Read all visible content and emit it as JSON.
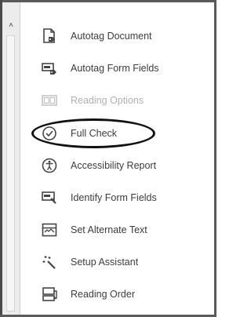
{
  "scrollbar": {
    "up_arrow": "˄"
  },
  "menu": {
    "items": [
      {
        "label": "Autotag Document",
        "icon": "document-tag-icon",
        "enabled": true
      },
      {
        "label": "Autotag Form Fields",
        "icon": "form-fields-tag-icon",
        "enabled": true
      },
      {
        "label": "Reading Options",
        "icon": "reading-options-icon",
        "enabled": false
      },
      {
        "label": "Full Check",
        "icon": "check-circle-icon",
        "enabled": true,
        "highlighted": true
      },
      {
        "label": "Accessibility Report",
        "icon": "accessibility-icon",
        "enabled": true
      },
      {
        "label": "Identify Form Fields",
        "icon": "identify-form-fields-icon",
        "enabled": true
      },
      {
        "label": "Set Alternate Text",
        "icon": "alternate-text-icon",
        "enabled": true
      },
      {
        "label": "Setup Assistant",
        "icon": "magic-wand-icon",
        "enabled": true
      },
      {
        "label": "Reading Order",
        "icon": "reading-order-icon",
        "enabled": true
      }
    ]
  },
  "colors": {
    "text": "#3c3c3c",
    "disabled_text": "#b0b0b0",
    "ellipse": "#111111"
  }
}
